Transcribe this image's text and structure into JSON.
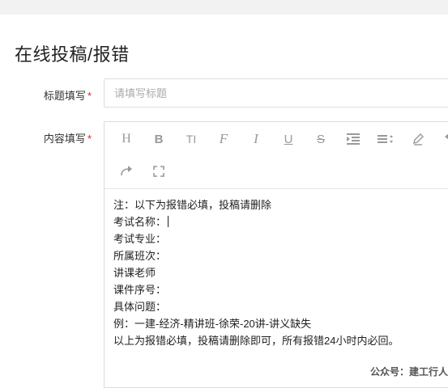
{
  "page": {
    "title": "在线投稿/报错"
  },
  "form": {
    "title_label": "标题填写",
    "title_placeholder": "请填写标题",
    "title_value": "",
    "content_label": "内容填写",
    "required_mark": "*"
  },
  "toolbar": {
    "heading": "H",
    "bold": "B",
    "font_size": "TI",
    "font_family": "F",
    "italic": "I",
    "underline": "U",
    "strikethrough": "S"
  },
  "editor": {
    "lines": [
      "注：以下为报错必填，投稿请删除",
      "考试名称：",
      "考试专业：",
      "所属班次：",
      "讲课老师",
      "课件序号：",
      "具体问题：",
      "例：一建-经济-精讲班-徐荣-20讲-讲义缺失",
      "以上为报错必填，投稿请删除即可，所有报错24小时内必回。"
    ]
  },
  "watermark": "公众号：建工行人"
}
